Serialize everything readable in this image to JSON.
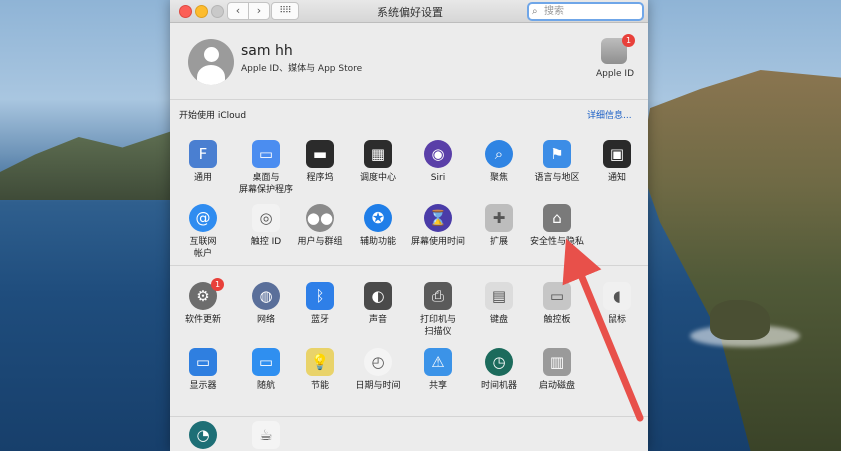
{
  "window": {
    "title": "系统偏好设置",
    "search_placeholder": "搜索"
  },
  "nav": {
    "back": "‹",
    "forward": "›",
    "grid": "⠿⠿"
  },
  "account": {
    "name": "sam hh",
    "subtitle": "Apple ID、媒体与 App Store",
    "apple_id_label": "Apple ID",
    "apple_id_badge": "1",
    "apple_id_glyph": ""
  },
  "icloud": {
    "text": "开始使用 iCloud",
    "more": "详细信息..."
  },
  "section1": [
    {
      "label": "通用",
      "icon": "general-icon",
      "color": "#4a7fd1",
      "glyph": "F"
    },
    {
      "label": "桌面与\n屏幕保护程序",
      "icon": "desktop-screensaver-icon",
      "color": "#4b8df0",
      "glyph": "▭"
    },
    {
      "label": "程序坞",
      "icon": "dock-icon",
      "color": "#2b2b2b",
      "glyph": "▬"
    },
    {
      "label": "调度中心",
      "icon": "mission-control-icon",
      "color": "#2c2c2c",
      "glyph": "▦"
    },
    {
      "label": "Siri",
      "icon": "siri-icon",
      "color": "#5a3fa8",
      "glyph": "◉"
    },
    {
      "label": "聚焦",
      "icon": "spotlight-icon",
      "color": "#2f84e3",
      "glyph": "⌕"
    },
    {
      "label": "语言与地区",
      "icon": "language-region-icon",
      "color": "#3c8de6",
      "glyph": "⚑"
    },
    {
      "label": "通知",
      "icon": "notifications-icon",
      "color": "#2a2a2a",
      "glyph": "▣"
    },
    {
      "label": "互联网\n帐户",
      "icon": "internet-accounts-icon",
      "color": "#2f8cf0",
      "glyph": "@"
    },
    {
      "label": "触控 ID",
      "icon": "touch-id-icon",
      "color": "#f2f2f2",
      "glyph": "◎"
    },
    {
      "label": "用户与群组",
      "icon": "users-groups-icon",
      "color": "#8a8a8a",
      "glyph": "●●"
    },
    {
      "label": "辅助功能",
      "icon": "accessibility-icon",
      "color": "#1f7ee8",
      "glyph": "✪"
    },
    {
      "label": "屏幕使用时间",
      "icon": "screen-time-icon",
      "color": "#4a3ca8",
      "glyph": "⌛"
    },
    {
      "label": "扩展",
      "icon": "extensions-icon",
      "color": "#bdbdbd",
      "glyph": "✚"
    },
    {
      "label": "安全性与隐私",
      "icon": "security-privacy-icon",
      "color": "#7a7a7a",
      "glyph": "⌂"
    }
  ],
  "section2": [
    {
      "label": "软件更新",
      "icon": "software-update-icon",
      "color": "#6d6d6d",
      "glyph": "⚙",
      "badge": "1"
    },
    {
      "label": "网络",
      "icon": "network-icon",
      "color": "#5a6f9a",
      "glyph": "◍"
    },
    {
      "label": "蓝牙",
      "icon": "bluetooth-icon",
      "color": "#2e7fe8",
      "glyph": "ᛒ"
    },
    {
      "label": "声音",
      "icon": "sound-icon",
      "color": "#4a4a4a",
      "glyph": "◐"
    },
    {
      "label": "打印机与\n扫描仪",
      "icon": "printers-scanners-icon",
      "color": "#5a5a5a",
      "glyph": "⎙"
    },
    {
      "label": "键盘",
      "icon": "keyboard-icon",
      "color": "#dcdcdc",
      "glyph": "▤"
    },
    {
      "label": "触控板",
      "icon": "trackpad-icon",
      "color": "#c6c6c6",
      "glyph": "▭"
    },
    {
      "label": "鼠标",
      "icon": "mouse-icon",
      "color": "#f0f0f0",
      "glyph": "◖"
    },
    {
      "label": "显示器",
      "icon": "displays-icon",
      "color": "#2f7fe0",
      "glyph": "▭"
    },
    {
      "label": "随航",
      "icon": "sidecar-icon",
      "color": "#2f8ff0",
      "glyph": "▭"
    },
    {
      "label": "节能",
      "icon": "energy-saver-icon",
      "color": "#e9d36a",
      "glyph": "💡"
    },
    {
      "label": "日期与时间",
      "icon": "date-time-icon",
      "color": "#f4f4f4",
      "glyph": "◴"
    },
    {
      "label": "共享",
      "icon": "sharing-icon",
      "color": "#3b93e8",
      "glyph": "⚠"
    },
    {
      "label": "时间机器",
      "icon": "time-machine-icon",
      "color": "#1c6b5c",
      "glyph": "◷"
    },
    {
      "label": "启动磁盘",
      "icon": "startup-disk-icon",
      "color": "#9a9a9a",
      "glyph": "▥"
    }
  ],
  "section3": [
    {
      "label": "",
      "icon": "flip4mac-icon",
      "color": "#1e6f76",
      "glyph": "◔"
    },
    {
      "label": "",
      "icon": "java-icon",
      "color": "#f4f4f4",
      "glyph": "☕"
    }
  ],
  "annotation": {
    "arrow_color": "#e8504a"
  }
}
